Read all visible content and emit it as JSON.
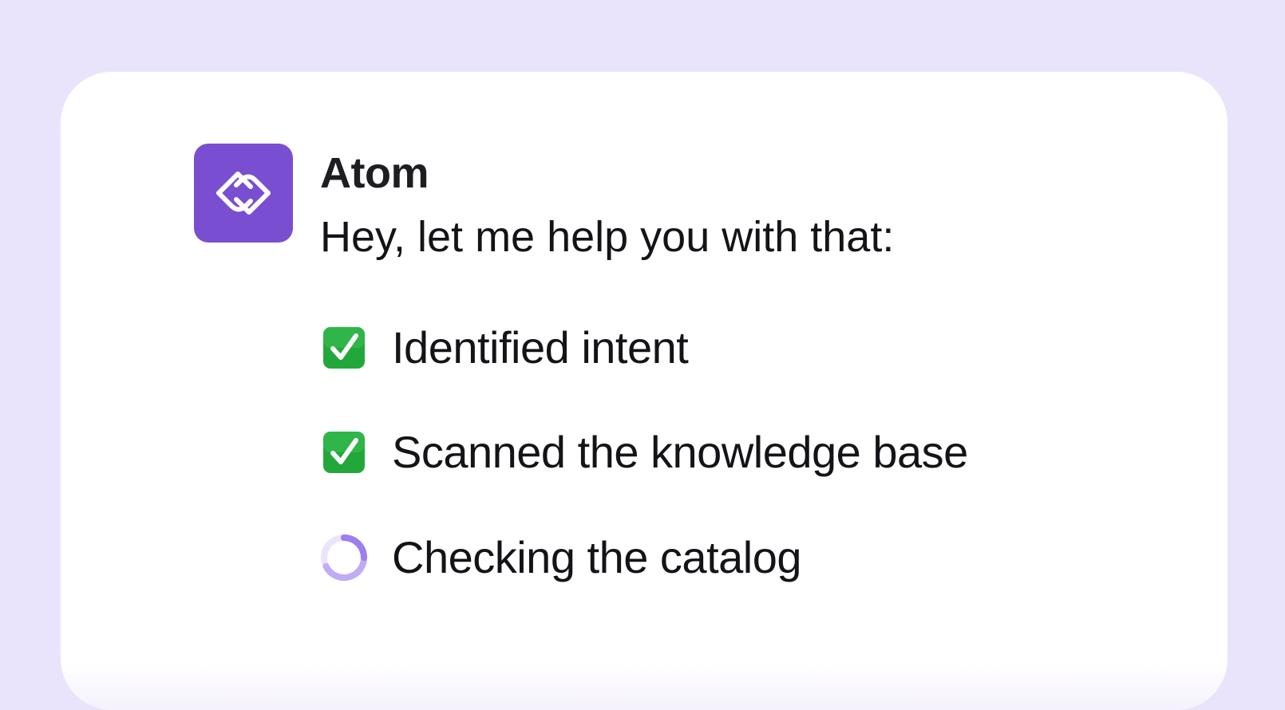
{
  "assistant": {
    "name": "Atom",
    "logo_icon": "atom-logo-icon",
    "brand_color": "#7a4ed0"
  },
  "message": {
    "text": "Hey, let me help you with that:"
  },
  "steps": [
    {
      "label": "Identified intent",
      "status": "done",
      "icon": "check-box-icon"
    },
    {
      "label": "Scanned the knowledge base",
      "status": "done",
      "icon": "check-box-icon"
    },
    {
      "label": "Checking the catalog",
      "status": "in-progress",
      "icon": "loading-spinner-icon"
    }
  ],
  "colors": {
    "background": "#e9e4fc",
    "card": "#ffffff",
    "check_green": "#22a83a",
    "spinner": "#b9a1f3"
  }
}
